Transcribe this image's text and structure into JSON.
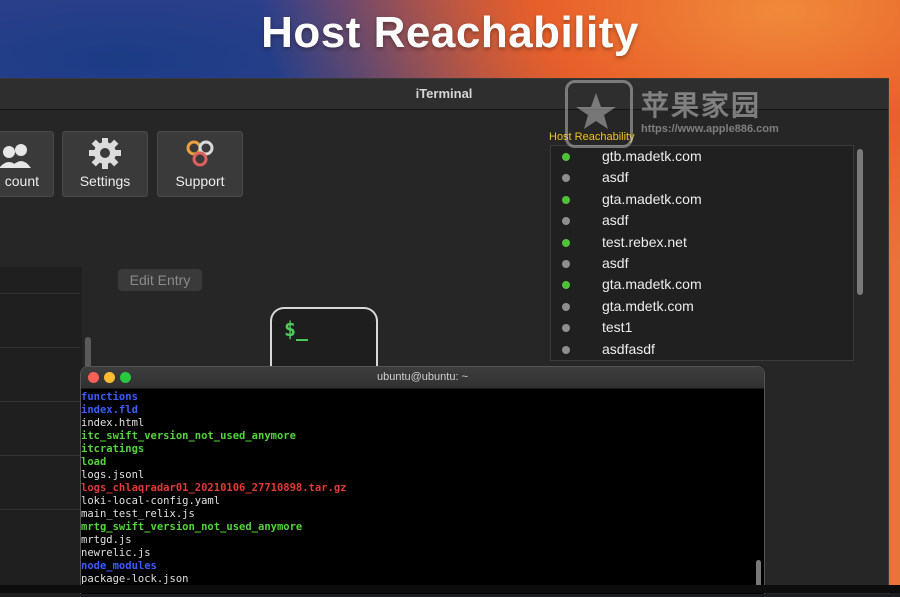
{
  "slide": {
    "title": "Host Reachability"
  },
  "app": {
    "title": "iTerminal"
  },
  "toolbar": {
    "account_label": "count",
    "settings_label": "Settings",
    "support_label": "Support"
  },
  "edit_entry": {
    "label": "Edit Entry"
  },
  "terminal_icon": {
    "prompt": "$_"
  },
  "host_reachability": {
    "title": "Host Reachability",
    "hosts": [
      {
        "name": "gtb.madetk.com",
        "status": "reachable"
      },
      {
        "name": "asdf",
        "status": "unknown"
      },
      {
        "name": "gta.madetk.com",
        "status": "reachable"
      },
      {
        "name": "asdf",
        "status": "unknown"
      },
      {
        "name": "test.rebex.net",
        "status": "reachable"
      },
      {
        "name": "asdf",
        "status": "unknown"
      },
      {
        "name": "gta.madetk.com",
        "status": "reachable"
      },
      {
        "name": "gta.mdetk.com",
        "status": "unknown"
      },
      {
        "name": "test1",
        "status": "unknown"
      },
      {
        "name": "asdfasdf",
        "status": "unknown"
      }
    ],
    "status_colors": {
      "reachable": "#4ec238",
      "unknown": "#8e8e8e"
    }
  },
  "watermark": {
    "text": "苹果家园",
    "url": "https://www.apple886.com"
  },
  "terminal": {
    "title": "ubuntu@ubuntu: ~",
    "lines": [
      {
        "text": "functions",
        "color": "#3b5cff"
      },
      {
        "text": "index.fld",
        "color": "#3b5cff"
      },
      {
        "text": "index.html",
        "color": "#e0e0e0"
      },
      {
        "text": "itc_swift_version_not_used_anymore",
        "color": "#52d43a"
      },
      {
        "text": "itcratings",
        "color": "#52d43a"
      },
      {
        "text": "load",
        "color": "#52d43a"
      },
      {
        "text": "logs.jsonl",
        "color": "#e0e0e0"
      },
      {
        "text": "logs_chlaqradar01_20210106_27710898.tar.gz",
        "color": "#e53935"
      },
      {
        "text": "loki-local-config.yaml",
        "color": "#e0e0e0"
      },
      {
        "text": "main_test_relix.js",
        "color": "#e0e0e0"
      },
      {
        "text": "mrtg_swift_version_not_used_anymore",
        "color": "#52d43a"
      },
      {
        "text": "mrtgd.js",
        "color": "#e0e0e0"
      },
      {
        "text": "newrelic.js",
        "color": "#e0e0e0"
      },
      {
        "text": "node_modules",
        "color": "#3b5cff"
      },
      {
        "text": "package-lock.json",
        "color": "#e0e0e0"
      }
    ]
  }
}
